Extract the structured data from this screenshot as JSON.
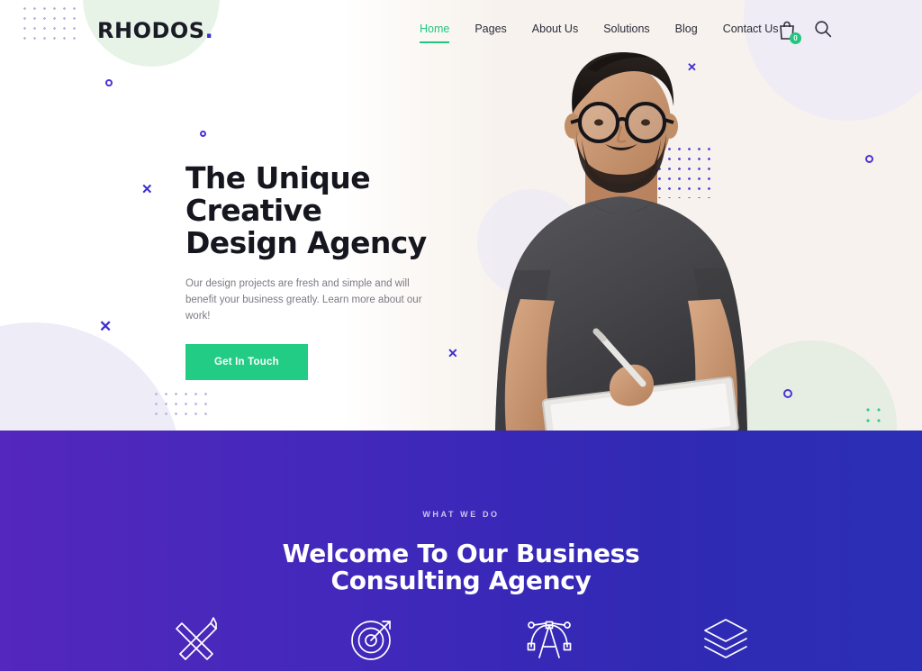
{
  "header": {
    "logo_text": "RHODOS",
    "logo_dot": ".",
    "nav": [
      {
        "label": "Home",
        "active": true
      },
      {
        "label": "Pages",
        "active": false
      },
      {
        "label": "About Us",
        "active": false
      },
      {
        "label": "Solutions",
        "active": false
      },
      {
        "label": "Blog",
        "active": false
      },
      {
        "label": "Contact Us",
        "active": false
      }
    ],
    "cart_count": "0",
    "cart_icon": "shopping-bag-icon",
    "search_icon": "search-icon"
  },
  "hero": {
    "title_line1": "The Unique Creative",
    "title_line2": "Design Agency",
    "subtitle": "Our design projects are fresh and simple and will benefit your business greatly. Learn more about our work!",
    "cta_label": "Get In Touch",
    "photo_alt": "bearded man with glasses holding a tablet and stylus"
  },
  "what_we_do": {
    "eyebrow": "WHAT WE DO",
    "title_line1": "Welcome To Our Business",
    "title_line2": "Consulting Agency",
    "services": [
      {
        "icon": "ruler-pencil-icon"
      },
      {
        "icon": "target-arrow-icon"
      },
      {
        "icon": "vector-typography-icon"
      },
      {
        "icon": "layers-icon"
      }
    ]
  },
  "colors": {
    "accent_green": "#23cc84",
    "accent_purple": "#3d2fd0",
    "purple_left": "#5427bd",
    "purple_right": "#2b2fb5",
    "hero_bg": "#f7f2ee",
    "heading_dark": "#16161f"
  }
}
